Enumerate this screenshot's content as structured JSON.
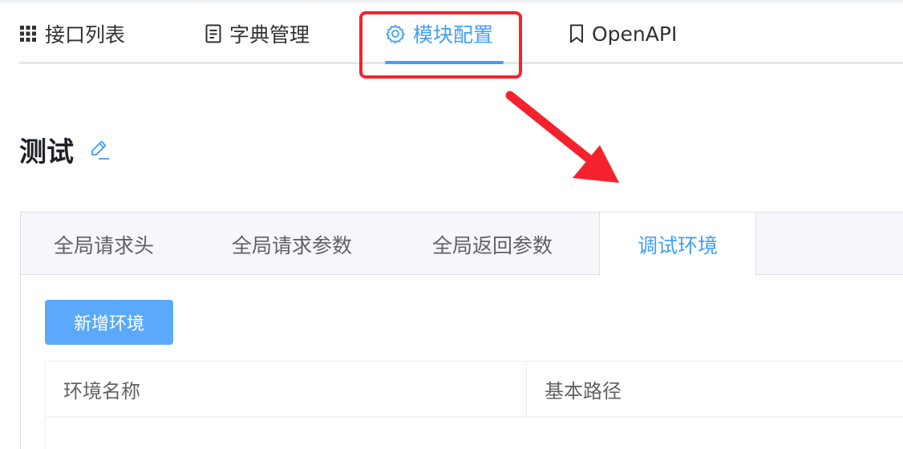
{
  "nav": {
    "items": [
      {
        "label": "接口列表",
        "icon": "grid-icon"
      },
      {
        "label": "字典管理",
        "icon": "document-icon"
      },
      {
        "label": "模块配置",
        "icon": "gear-icon"
      },
      {
        "label": "OpenAPI",
        "icon": "bookmark-icon"
      }
    ],
    "active": "模块配置"
  },
  "page": {
    "title": "测试",
    "title_icon": "edit-icon"
  },
  "sub_tabs": {
    "items": [
      {
        "label": "全局请求头"
      },
      {
        "label": "全局请求参数"
      },
      {
        "label": "全局返回参数"
      },
      {
        "label": "调试环境"
      }
    ],
    "active": "调试环境"
  },
  "toolbar": {
    "add_label": "新增环境"
  },
  "table": {
    "columns": [
      "环境名称",
      "基本路径"
    ],
    "rows": []
  },
  "colors": {
    "accent": "#409eff",
    "highlight": "#f5222d",
    "button": "#5aa9fc"
  }
}
